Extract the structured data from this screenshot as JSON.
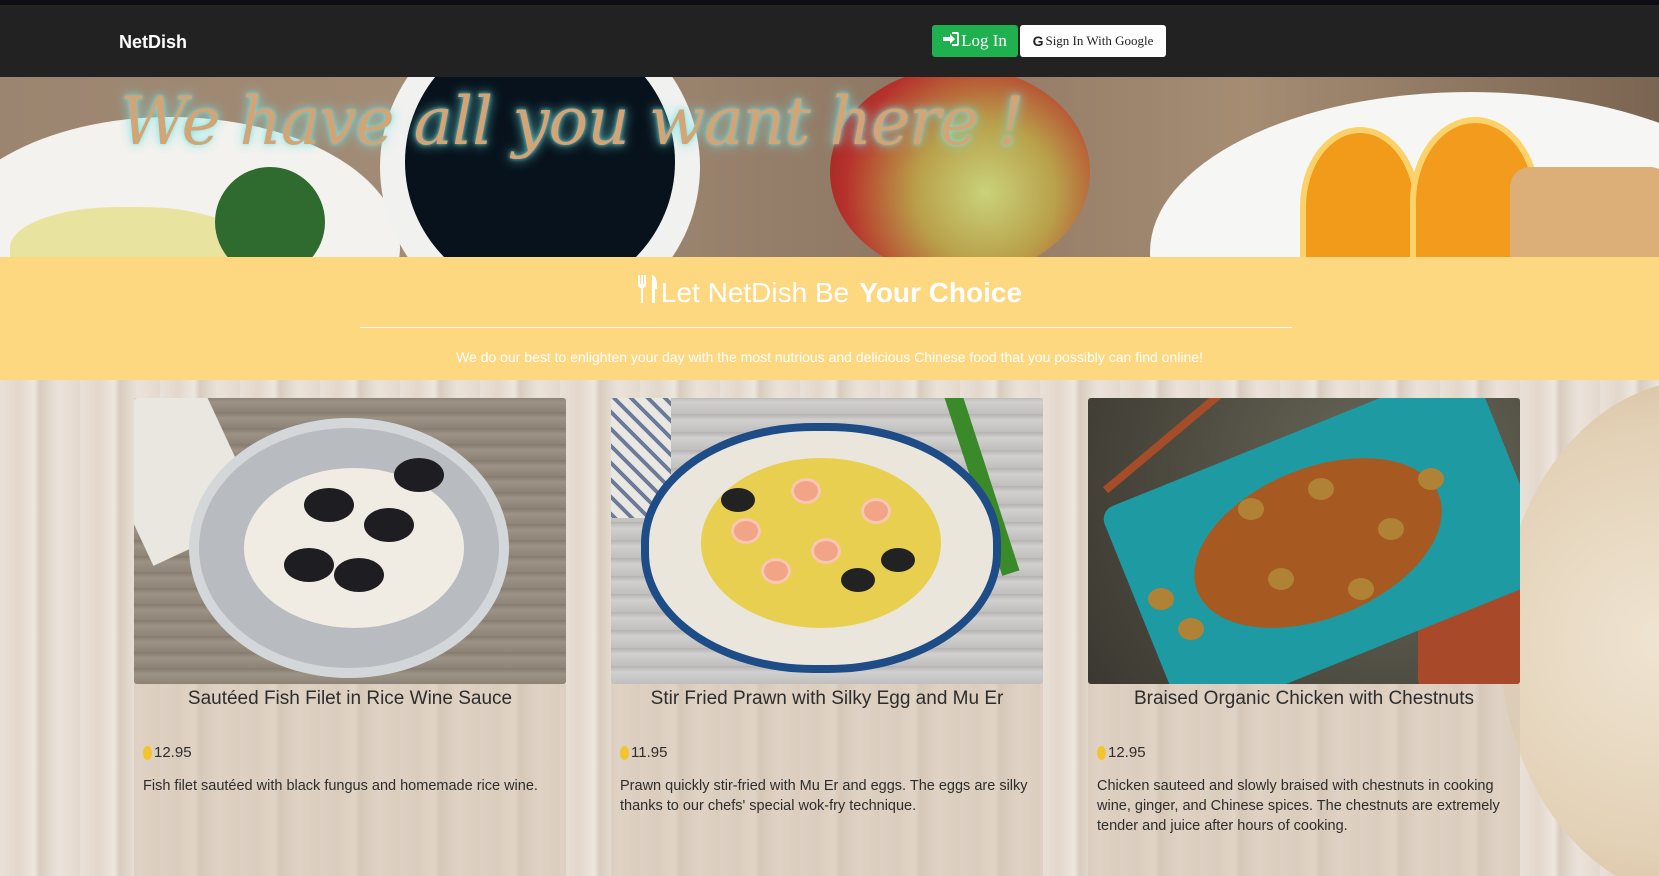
{
  "navbar": {
    "brand": "NetDish",
    "login_label": "Log In",
    "google_label": "Sign In With Google",
    "login_icon": "sign-in-icon",
    "google_icon": "google-icon"
  },
  "hero": {
    "title": "We have all you want here !"
  },
  "banner": {
    "title_plain": "Let NetDish Be",
    "title_bold": "Your Choice",
    "icon": "utensils-icon",
    "tagline": "We do our best to enlighten your day with the most nutrious and delicious Chinese food that you possibly can find online!"
  },
  "dishes": [
    {
      "name": "Sautéed Fish Filet in Rice Wine Sauce",
      "price": "12.95",
      "description": "Fish filet sautéed with black fungus and homemade rice wine."
    },
    {
      "name": "Stir Fried Prawn with Silky Egg and Mu Er",
      "price": "11.95",
      "description": "Prawn quickly stir-fried with Mu Er and eggs. The eggs are silky thanks to our chefs' special wok-fry technique."
    },
    {
      "name": "Braised Organic Chicken with Chestnuts",
      "price": "12.95",
      "description": "Chicken sauteed and slowly braised with chestnuts in cooking wine, ginger, and Chinese spices. The chestnuts are extremely tender and juice after hours of cooking."
    }
  ],
  "colors": {
    "navbar_bg": "#222222",
    "login_green": "#1fb04f",
    "banner_yellow": "#fdd880",
    "hero_title": "#d3a475"
  }
}
